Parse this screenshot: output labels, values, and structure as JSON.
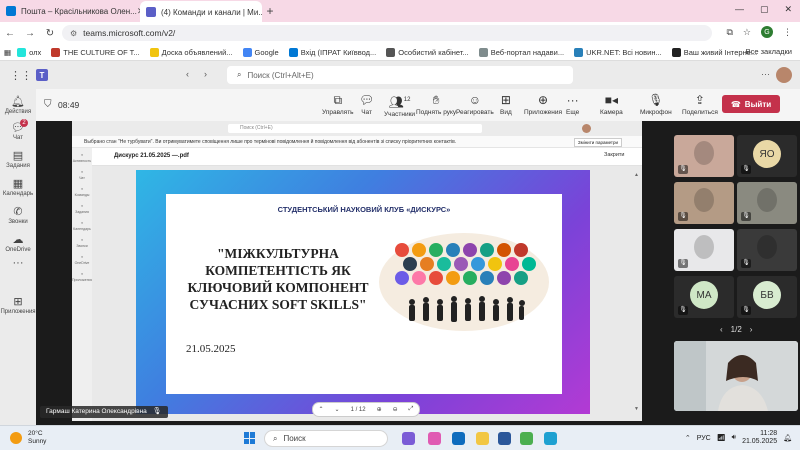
{
  "browser": {
    "tabs": [
      {
        "title": "Пошта – Красільникова Олен...",
        "favicon_color": "#0078d4"
      },
      {
        "title": "(4) Команди и канали | Ми...",
        "favicon_color": "#5b5fc7"
      }
    ],
    "url": "teams.microsoft.com/v2/",
    "bookmarks": [
      {
        "label": "олх",
        "color": "#23e5db"
      },
      {
        "label": "THE CULTURE OF T...",
        "color": "#c0392b"
      },
      {
        "label": "Доска объявлений...",
        "color": "#f1c40f"
      },
      {
        "label": "Google",
        "color": "#4285f4"
      },
      {
        "label": "Вхід (ІПРАТ Київвод...",
        "color": "#0078d4"
      },
      {
        "label": "Особистий кабінет...",
        "color": "#555555"
      },
      {
        "label": "Веб-портал надави...",
        "color": "#7f8c8d"
      },
      {
        "label": "UKR.NET: Всі новин...",
        "color": "#2980b9"
      },
      {
        "label": "Ваш живий Інтерне...",
        "color": "#222222"
      }
    ],
    "all_bookmarks": "Все закладки",
    "profile_initial": "G"
  },
  "teams": {
    "search_placeholder": "Поиск (Ctrl+Alt+E)",
    "rail": [
      {
        "label": "Действия",
        "icon": "bell-icon"
      },
      {
        "label": "Чат",
        "icon": "chat-icon",
        "badge": "2"
      },
      {
        "label": "Задания",
        "icon": "assignments-icon"
      },
      {
        "label": "Календарь",
        "icon": "calendar-icon"
      },
      {
        "label": "Звонки",
        "icon": "phone-icon"
      },
      {
        "label": "OneDrive",
        "icon": "cloud-icon"
      },
      {
        "label": "Приложения",
        "icon": "apps-icon"
      }
    ],
    "meeting": {
      "timer": "08:49",
      "tools": [
        {
          "label": "Управлять",
          "icon": "manage-icon"
        },
        {
          "label": "Чат",
          "icon": "chat-icon"
        },
        {
          "label": "Участники",
          "icon": "people-icon",
          "count": "12"
        },
        {
          "label": "Поднять руку",
          "icon": "hand-icon"
        },
        {
          "label": "Реагировать",
          "icon": "smile-icon"
        },
        {
          "label": "Вид",
          "icon": "view-icon"
        },
        {
          "label": "Приложения",
          "icon": "apps-icon"
        },
        {
          "label": "Еще",
          "icon": "more-icon"
        },
        {
          "label": "Камера",
          "icon": "camera-icon"
        },
        {
          "label": "Микрофон",
          "icon": "mic-icon"
        },
        {
          "label": "Поделиться",
          "icon": "share-icon"
        }
      ],
      "leave_label": "Выйти",
      "leave_color": "#c4314b",
      "presenter_name": "Гармаш Катерина Олександрівна",
      "pager": "1/2",
      "participants": [
        {
          "type": "video",
          "color": "#c9a89a"
        },
        {
          "type": "initials",
          "initials": "ЯО",
          "color": "#e9d8a6"
        },
        {
          "type": "video",
          "color": "#b49b85"
        },
        {
          "type": "video",
          "color": "#8a8a80"
        },
        {
          "type": "video",
          "color": "#e8e8ea"
        },
        {
          "type": "video",
          "color": "#3a3a3a"
        },
        {
          "type": "initials",
          "initials": "МА",
          "color": "#cfe7c6"
        },
        {
          "type": "initials",
          "initials": "БВ",
          "color": "#d8ecd0"
        }
      ]
    }
  },
  "shared": {
    "search_placeholder": "Поиск (Ctrl+E)",
    "warning": "Выбрано стан \"Не турбувати\". Ви отримуватимете сповіщення лише про термінові повідомлення й повідомлення від абонентів зі списку пріоритетних контактів.",
    "warning_button": "Змінити параметри",
    "file_name": "Дискурс 21.05.2025 —.pdf",
    "close_label": "Закрити",
    "rail": [
      "Активность",
      "Чат",
      "Команды",
      "Задания",
      "Календарь",
      "Звонки",
      "OneDrive",
      "Приложения"
    ],
    "page_indicator": "1 / 12",
    "slide": {
      "club": "СТУДЕНТСЬКИЙ НАУКОВИЙ КЛУБ «ДИСКУРС»",
      "title_lines": [
        "\"МІЖКУЛЬТУРНА",
        "КОМПЕТЕНТІСТЬ ЯК",
        "КЛЮЧОВИЙ КОМПОНЕНТ",
        "СУЧАСНИХ SOFT SKILLS\""
      ],
      "date": "21.05.2025"
    }
  },
  "taskbar": {
    "temp": "20°C",
    "condition": "Sunny",
    "search": "Поиск",
    "lang": "РУС",
    "time": "11:28",
    "date": "21.05.2025"
  }
}
